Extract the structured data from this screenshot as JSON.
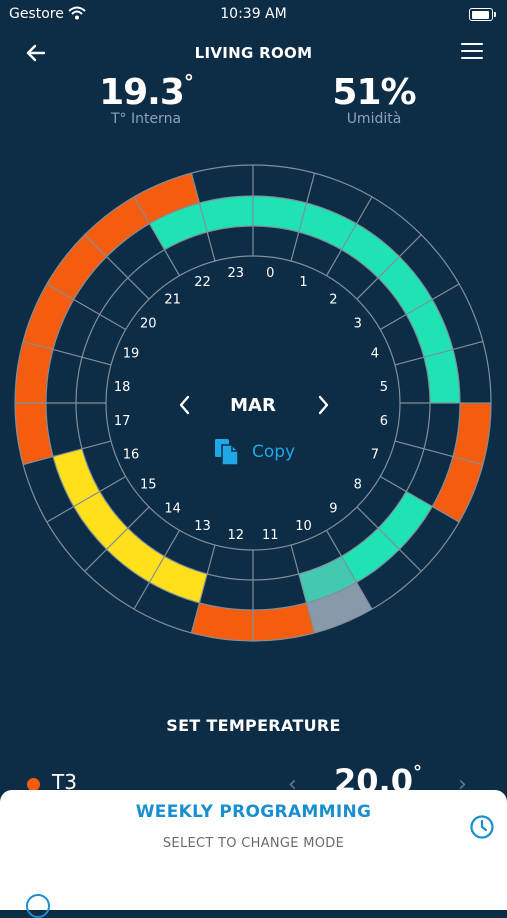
{
  "status": {
    "carrier": "Gestore",
    "time": "10:39 AM"
  },
  "header": {
    "title": "LIVING ROOM"
  },
  "readings": {
    "temperature": {
      "value": "19.3",
      "unit": "°",
      "label": "T° Interna"
    },
    "humidity": {
      "value": "51%",
      "label": "Umidità"
    }
  },
  "schedule": {
    "day": "MAR",
    "copy_label": "Copy",
    "hours": [
      "0",
      "1",
      "2",
      "3",
      "4",
      "5",
      "6",
      "7",
      "8",
      "9",
      "10",
      "11",
      "12",
      "13",
      "14",
      "15",
      "16",
      "17",
      "18",
      "19",
      "20",
      "21",
      "22",
      "23"
    ],
    "colors": {
      "T1": "#1fe3b3",
      "T2": "#ffe01a",
      "T3": "#f45d0f",
      "selected": "#8899aa"
    },
    "segments": [
      {
        "level": 1,
        "start": 22,
        "end": 6,
        "color": "T1"
      },
      {
        "level": 1,
        "start": 8,
        "end": 10,
        "color": "T1"
      },
      {
        "level": 1,
        "start": 10,
        "end": 11,
        "color": "selected"
      },
      {
        "level": 1,
        "start": 10,
        "end": 11,
        "color": "T1"
      },
      {
        "level": 2,
        "start": 10,
        "end": 11,
        "color": "selected"
      },
      {
        "level": 2,
        "start": 11,
        "end": 13,
        "color": "T3"
      },
      {
        "level": 1,
        "start": 13,
        "end": 17,
        "color": "T2"
      },
      {
        "level": 2,
        "start": 17,
        "end": 23,
        "color": "T3"
      },
      {
        "level": 2,
        "start": 6,
        "end": 8,
        "color": "T3"
      }
    ]
  },
  "set_temperature": {
    "title": "SET TEMPERATURE",
    "slot": "T3",
    "value": "20.0",
    "unit": "°",
    "prev": "‹",
    "next": "›"
  },
  "mode_sheet": {
    "title": "WEEKLY PROGRAMMING",
    "subtitle": "SELECT TO CHANGE MODE",
    "icon": "clock-icon"
  }
}
